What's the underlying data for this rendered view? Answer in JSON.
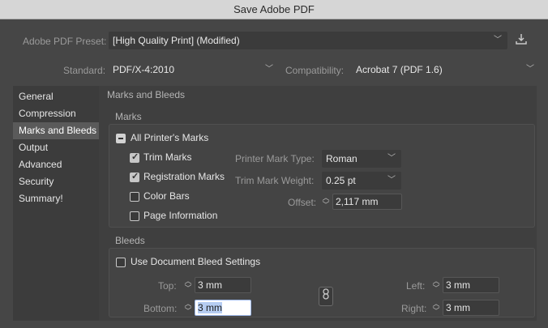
{
  "window": {
    "title": "Save Adobe PDF"
  },
  "preset": {
    "label": "Adobe PDF Preset:",
    "value": "[High Quality Print] (Modified)",
    "save_icon": "save-preset-icon"
  },
  "standard": {
    "label": "Standard:",
    "value": "PDF/X-4:2010"
  },
  "compatibility": {
    "label": "Compatibility:",
    "value": "Acrobat 7 (PDF 1.6)"
  },
  "sidebar": {
    "items": [
      {
        "label": "General"
      },
      {
        "label": "Compression"
      },
      {
        "label": "Marks and Bleeds",
        "selected": true
      },
      {
        "label": "Output"
      },
      {
        "label": "Advanced"
      },
      {
        "label": "Security"
      },
      {
        "label": "Summary!"
      }
    ]
  },
  "panel": {
    "title": "Marks and Bleeds",
    "marks": {
      "title": "Marks",
      "all_printers_marks": {
        "label": "All Printer's Marks",
        "state": "mixed"
      },
      "trim_marks": {
        "label": "Trim Marks",
        "checked": true
      },
      "registration_marks": {
        "label": "Registration Marks",
        "checked": true
      },
      "color_bars": {
        "label": "Color Bars",
        "checked": false
      },
      "page_information": {
        "label": "Page Information",
        "checked": false
      },
      "printer_mark_type": {
        "label": "Printer Mark Type:",
        "value": "Roman"
      },
      "trim_mark_weight": {
        "label": "Trim Mark Weight:",
        "value": "0.25 pt"
      },
      "offset": {
        "label": "Offset:",
        "value": "2,117 mm"
      }
    },
    "bleeds": {
      "title": "Bleeds",
      "use_document": {
        "label": "Use Document Bleed Settings",
        "checked": false
      },
      "top": {
        "label": "Top:",
        "value": "3 mm"
      },
      "bottom": {
        "label": "Bottom:",
        "value": "3 mm"
      },
      "left": {
        "label": "Left:",
        "value": "3 mm"
      },
      "right": {
        "label": "Right:",
        "value": "3 mm"
      },
      "link_icon": "chain-link-icon"
    }
  }
}
